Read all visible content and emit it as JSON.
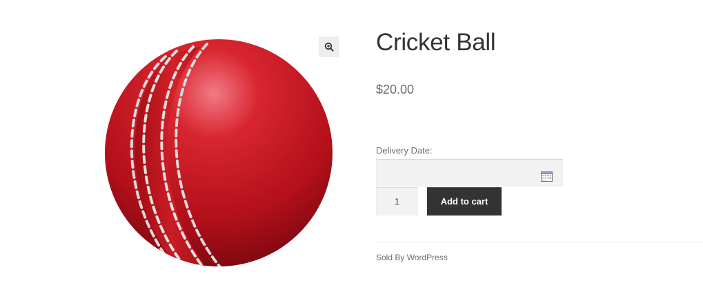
{
  "product": {
    "title": "Cricket Ball",
    "price": "$20.00",
    "image_alt": "Cricket Ball",
    "image_icon": "cricket-ball-image"
  },
  "gallery": {
    "zoom_icon": "zoom-in-icon"
  },
  "delivery": {
    "label": "Delivery Date:",
    "value": "",
    "calendar_icon": "calendar-icon"
  },
  "cart": {
    "quantity": "1",
    "button_label": "Add to cart"
  },
  "vendor": {
    "sold_by": "Sold By WordPress"
  },
  "colors": {
    "ball": "#c8102e",
    "button": "#333333",
    "input_bg": "#f2f2f2",
    "zoom_bg": "#eeeeee"
  }
}
